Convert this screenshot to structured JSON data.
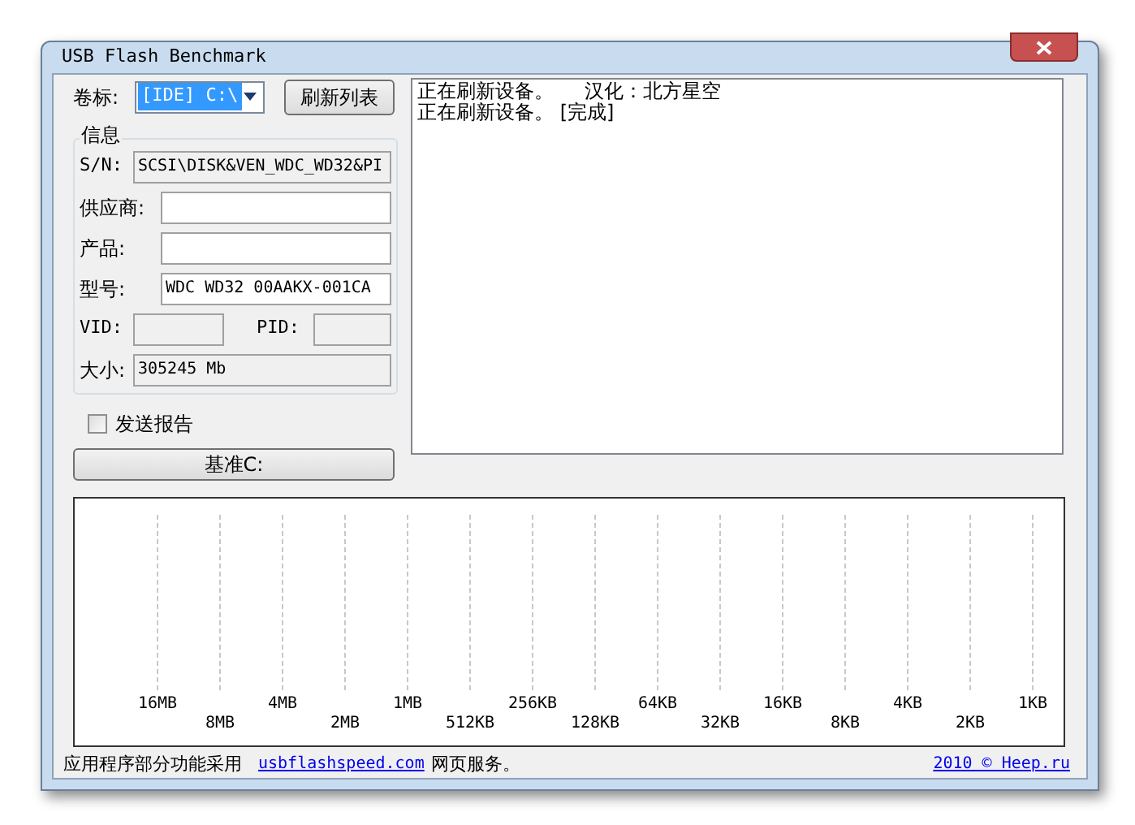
{
  "window": {
    "title": "USB Flash Benchmark"
  },
  "volume": {
    "label": "卷标:",
    "value": "[IDE] C:\\",
    "refresh_button": "刷新列表"
  },
  "info": {
    "title": "信息",
    "fields": [
      {
        "label": "S/N:",
        "value": "SCSI\\DISK&VEN_WDC_WD32&PI"
      },
      {
        "label": "供应商:"
      },
      {
        "label": "产品:"
      },
      {
        "label": "型号:",
        "value": "WDC WD32 00AAKX-001CA"
      }
    ],
    "vid_label": "VID:",
    "pid_label": "PID:",
    "size_label": "大小:",
    "size_value": "305245 Mb"
  },
  "send_report": {
    "label": "发送报告",
    "checked": false
  },
  "benchmark_button": "基准C:",
  "log": [
    "正在刷新设备。     汉化：北方星空",
    "正在刷新设备。 [完成]"
  ],
  "chart_labels": [
    "16MB",
    "8MB",
    "4MB",
    "2MB",
    "1MB",
    "512KB",
    "256KB",
    "128KB",
    "64KB",
    "32KB",
    "16KB",
    "8KB",
    "4KB",
    "2KB",
    "1KB"
  ],
  "footer": {
    "text": "应用程序部分功能采用",
    "link": "usbflashspeed.com",
    "text_after": "网页服务。",
    "copyright": "2010 © Heep.ru"
  }
}
